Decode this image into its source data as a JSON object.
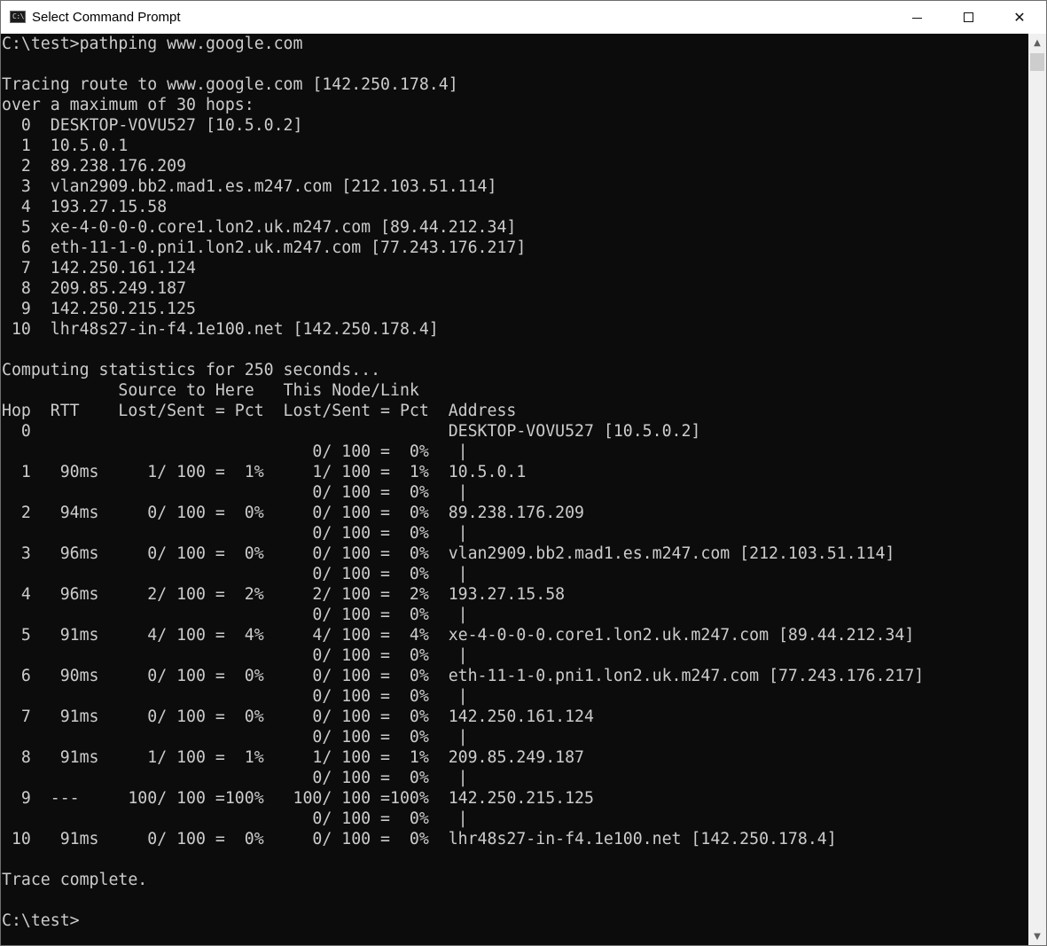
{
  "window": {
    "title": "Select Command Prompt",
    "icon": "cmd-icon",
    "icon_glyph": "C:\\."
  },
  "controls": {
    "minimize_icon": "minimize-icon",
    "maximize_icon": "maximize-icon",
    "close_icon": "close-icon",
    "close_glyph": "✕"
  },
  "scrollbar": {
    "up_glyph": "▲",
    "down_glyph": "▼"
  },
  "colors": {
    "console_background": "#0c0c0c",
    "console_text": "#cccccc",
    "titlebar_background": "#ffffff"
  },
  "console": {
    "lines": [
      "C:\\test>pathping www.google.com",
      "",
      "Tracing route to www.google.com [142.250.178.4]",
      "over a maximum of 30 hops:",
      "  0  DESKTOP-VOVU527 [10.5.0.2]",
      "  1  10.5.0.1",
      "  2  89.238.176.209",
      "  3  vlan2909.bb2.mad1.es.m247.com [212.103.51.114]",
      "  4  193.27.15.58",
      "  5  xe-4-0-0-0.core1.lon2.uk.m247.com [89.44.212.34]",
      "  6  eth-11-1-0.pni1.lon2.uk.m247.com [77.243.176.217]",
      "  7  142.250.161.124",
      "  8  209.85.249.187",
      "  9  142.250.215.125",
      " 10  lhr48s27-in-f4.1e100.net [142.250.178.4]",
      "",
      "Computing statistics for 250 seconds...",
      "            Source to Here   This Node/Link",
      "Hop  RTT    Lost/Sent = Pct  Lost/Sent = Pct  Address",
      "  0                                           DESKTOP-VOVU527 [10.5.0.2]",
      "                                0/ 100 =  0%   |",
      "  1   90ms     1/ 100 =  1%     1/ 100 =  1%  10.5.0.1",
      "                                0/ 100 =  0%   |",
      "  2   94ms     0/ 100 =  0%     0/ 100 =  0%  89.238.176.209",
      "                                0/ 100 =  0%   |",
      "  3   96ms     0/ 100 =  0%     0/ 100 =  0%  vlan2909.bb2.mad1.es.m247.com [212.103.51.114]",
      "                                0/ 100 =  0%   |",
      "  4   96ms     2/ 100 =  2%     2/ 100 =  2%  193.27.15.58",
      "                                0/ 100 =  0%   |",
      "  5   91ms     4/ 100 =  4%     4/ 100 =  4%  xe-4-0-0-0.core1.lon2.uk.m247.com [89.44.212.34]",
      "                                0/ 100 =  0%   |",
      "  6   90ms     0/ 100 =  0%     0/ 100 =  0%  eth-11-1-0.pni1.lon2.uk.m247.com [77.243.176.217]",
      "                                0/ 100 =  0%   |",
      "  7   91ms     0/ 100 =  0%     0/ 100 =  0%  142.250.161.124",
      "                                0/ 100 =  0%   |",
      "  8   91ms     1/ 100 =  1%     1/ 100 =  1%  209.85.249.187",
      "                                0/ 100 =  0%   |",
      "  9  ---     100/ 100 =100%   100/ 100 =100%  142.250.215.125",
      "                                0/ 100 =  0%   |",
      " 10   91ms     0/ 100 =  0%     0/ 100 =  0%  lhr48s27-in-f4.1e100.net [142.250.178.4]",
      "",
      "Trace complete.",
      "",
      "C:\\test>"
    ]
  }
}
